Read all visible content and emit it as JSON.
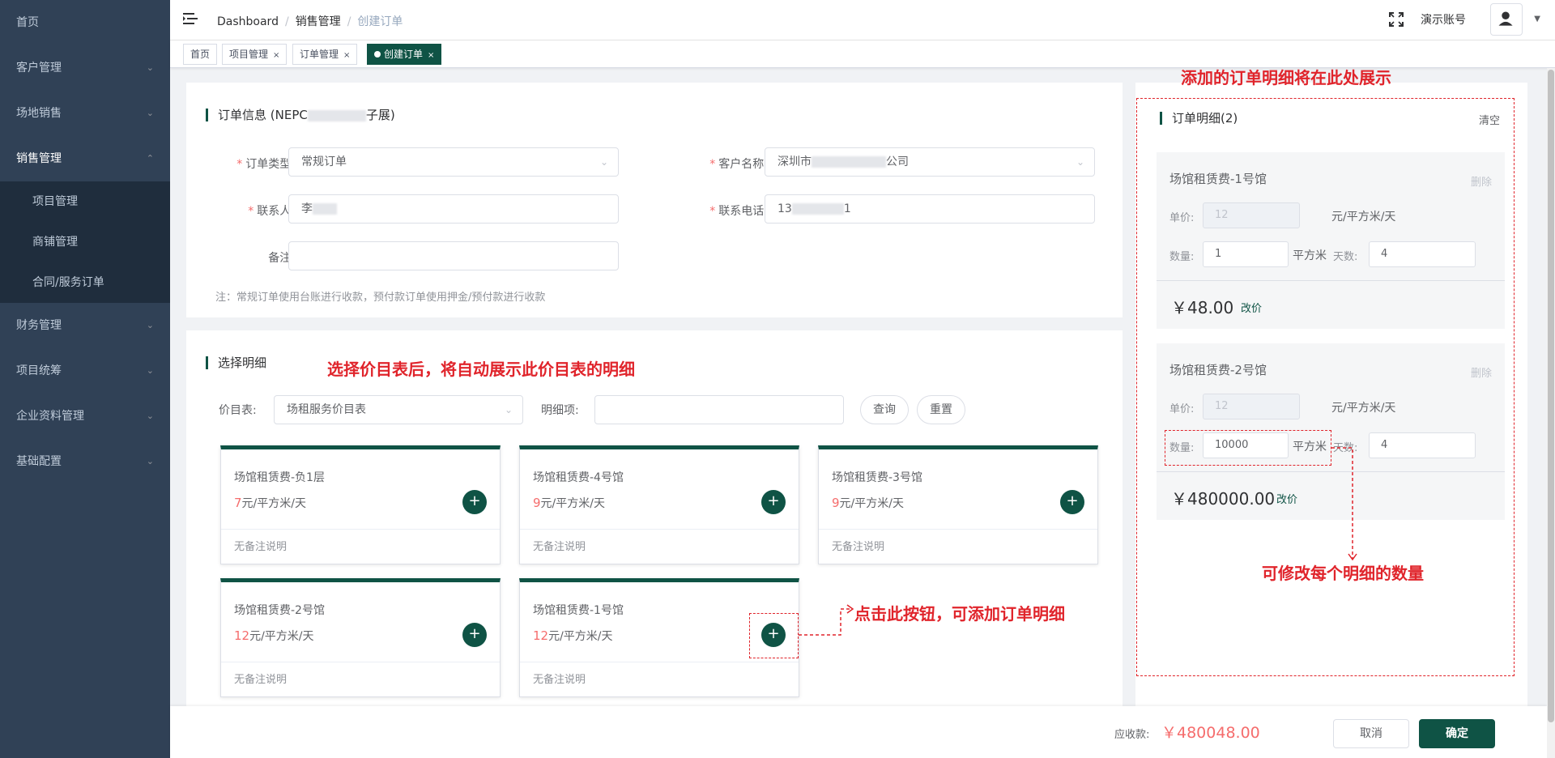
{
  "sidebar": {
    "items": [
      {
        "label": "首页"
      },
      {
        "label": "客户管理"
      },
      {
        "label": "场地销售"
      },
      {
        "label": "销售管理"
      },
      {
        "label": "财务管理"
      },
      {
        "label": "项目统筹"
      },
      {
        "label": "企业资料管理"
      },
      {
        "label": "基础配置"
      }
    ],
    "sub_items": [
      {
        "label": "项目管理"
      },
      {
        "label": "商铺管理"
      },
      {
        "label": "合同/服务订单"
      }
    ]
  },
  "header": {
    "breadcrumb": [
      "Dashboard",
      "销售管理",
      "创建订单"
    ],
    "account_name": "演示账号"
  },
  "tags": [
    {
      "label": "首页"
    },
    {
      "label": "项目管理"
    },
    {
      "label": "订单管理"
    },
    {
      "label": "创建订单"
    }
  ],
  "order_info": {
    "title": "订单信息 (NEPC",
    "title_suffix": "子展)",
    "order_type_label": "订单类型:",
    "order_type_value": "常规订单",
    "customer_label": "客户名称:",
    "customer_value_prefix": "深圳市",
    "customer_value_suffix": "公司",
    "contact_label": "联系人:",
    "contact_value": "李",
    "phone_label": "联系电话:",
    "phone_value_prefix": "13",
    "phone_value_suffix": "1",
    "remark_label": "备注:",
    "remark_value": "",
    "note": "注：常规订单使用台账进行收款，预付款订单使用押金/预付款进行收款"
  },
  "select_details": {
    "title": "选择明细",
    "price_list_label": "价目表:",
    "price_list_value": "场租服务价目表",
    "detail_label": "明细项:",
    "detail_value": "",
    "query_button": "查询",
    "reset_button": "重置",
    "cards": [
      {
        "name": "场馆租赁费-负1层",
        "price": "7",
        "unit": "元/平方米/天",
        "remark": "无备注说明"
      },
      {
        "name": "场馆租赁费-4号馆",
        "price": "9",
        "unit": "元/平方米/天",
        "remark": "无备注说明"
      },
      {
        "name": "场馆租赁费-3号馆",
        "price": "9",
        "unit": "元/平方米/天",
        "remark": "无备注说明"
      },
      {
        "name": "场馆租赁费-2号馆",
        "price": "12",
        "unit": "元/平方米/天",
        "remark": "无备注说明"
      },
      {
        "name": "场馆租赁费-1号馆",
        "price": "12",
        "unit": "元/平方米/天",
        "remark": "无备注说明"
      }
    ]
  },
  "order_detail": {
    "title": "订单明细(2)",
    "clear_button": "清空",
    "items": [
      {
        "name": "场馆租赁费-1号馆",
        "delete": "删除",
        "price_label": "单价:",
        "price": "12",
        "price_unit": "元/平方米/天",
        "qty_label": "数量:",
        "qty": "1",
        "qty_unit": "平方米",
        "days_label": "天数:",
        "days": "4",
        "total": "￥48.00",
        "reprice": "改价"
      },
      {
        "name": "场馆租赁费-2号馆",
        "delete": "删除",
        "price_label": "单价:",
        "price": "12",
        "price_unit": "元/平方米/天",
        "qty_label": "数量:",
        "qty": "10000",
        "qty_unit": "平方米",
        "days_label": "天数:",
        "days": "4",
        "total": "￥480000.00",
        "reprice": "改价"
      }
    ]
  },
  "annotations": {
    "top": "添加的订单明细将在此处展示",
    "middle": "选择价目表后，将自动展示此价目表的明细",
    "add_hint": "点击此按钮，可添加订单明细",
    "qty_hint": "可修改每个明细的数量"
  },
  "footer": {
    "receivable_label": "应收款:",
    "receivable_value": "￥480048.00",
    "cancel_button": "取消",
    "confirm_button": "确定"
  },
  "colors": {
    "primary": "#0f5345",
    "sidebar_bg": "#304156",
    "annotation_red": "#e0242b",
    "price_red": "#f56c6c"
  }
}
